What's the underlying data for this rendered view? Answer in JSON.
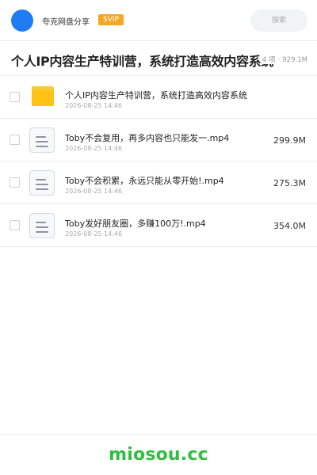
{
  "header": {
    "app_name": "夸克网盘分享",
    "badge": "SVIP",
    "search_placeholder": "搜索"
  },
  "folder": {
    "title": "个人IP内容生产特训营，系统打造高效内容系统",
    "item_count": "4 项",
    "meta_separator": "·",
    "total_size": "929.1M"
  },
  "files": [
    {
      "type": "folder",
      "icon": "folder-icon",
      "name": "个人IP内容生产特训营，系统打造高效内容系统",
      "date": "2026-08-25 14:46",
      "size": ""
    },
    {
      "type": "file",
      "icon": "document-icon",
      "name": "Toby不会复用，再多内容也只能发一.mp4",
      "date": "2026-08-25 14:46",
      "size": "299.9M"
    },
    {
      "type": "file",
      "icon": "document-icon",
      "name": "Toby不会积累，永远只能从零开始!.mp4",
      "date": "2026-08-25 14:46",
      "size": "275.3M"
    },
    {
      "type": "file",
      "icon": "document-icon",
      "name": "Toby发好朋友圈，多赚100万!.mp4",
      "date": "2026-08-25 14:46",
      "size": "354.0M"
    }
  ],
  "footer": {
    "watermark": "miosou.cc"
  },
  "colors": {
    "accent_blue": "#1f7cf4",
    "svip_orange": "#f5a623",
    "folder_yellow": "#ffc316",
    "watermark_green": "#2ebf3d"
  }
}
